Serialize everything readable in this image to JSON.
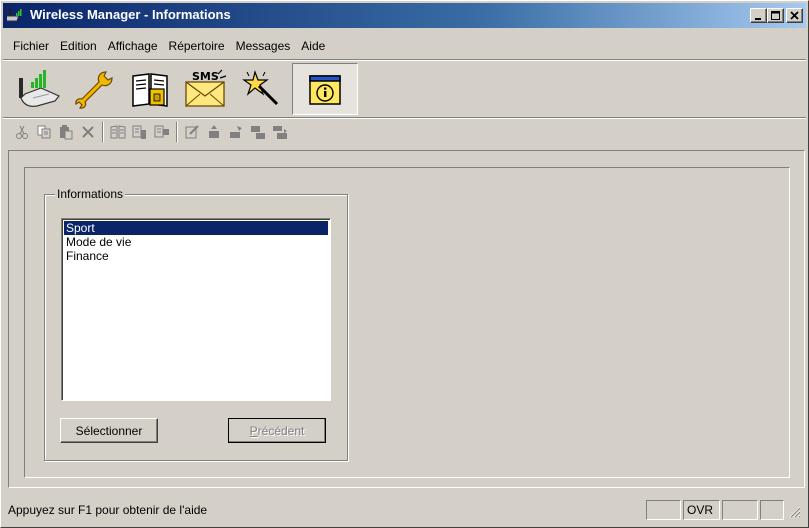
{
  "window": {
    "title": "Wireless Manager - Informations"
  },
  "menu": [
    "Fichier",
    "Edition",
    "Affichage",
    "Répertoire",
    "Messages",
    "Aide"
  ],
  "toolbar_icons": [
    "phone-connect-icon",
    "wrench-icon",
    "sim-card-book-icon",
    "sms-envelope-icon",
    "magic-wand-icon",
    "information-icon"
  ],
  "small_toolbar_icons": [
    "cut-icon",
    "copy-icon",
    "paste-icon",
    "delete-icon",
    "book-icon",
    "copy-to-phone-icon",
    "copy-from-phone-icon",
    "edit-icon",
    "upload-icon",
    "download-icon",
    "transfer-to-icon",
    "transfer-from-icon"
  ],
  "panel": {
    "group_title": "Informations",
    "list_items": [
      "Sport",
      "Mode de vie",
      "Finance"
    ],
    "selected_index": 0,
    "select_button": "Sélectionner",
    "previous_button": {
      "accel": "P",
      "rest": "récédent"
    }
  },
  "status": {
    "text": "Appuyez sur F1 pour obtenir de l'aide",
    "indicator": "OVR"
  },
  "colors": {
    "title_start": "#0a246a",
    "title_end": "#a6caf0",
    "selection": "#0a246a",
    "face": "#d4d0c8"
  }
}
